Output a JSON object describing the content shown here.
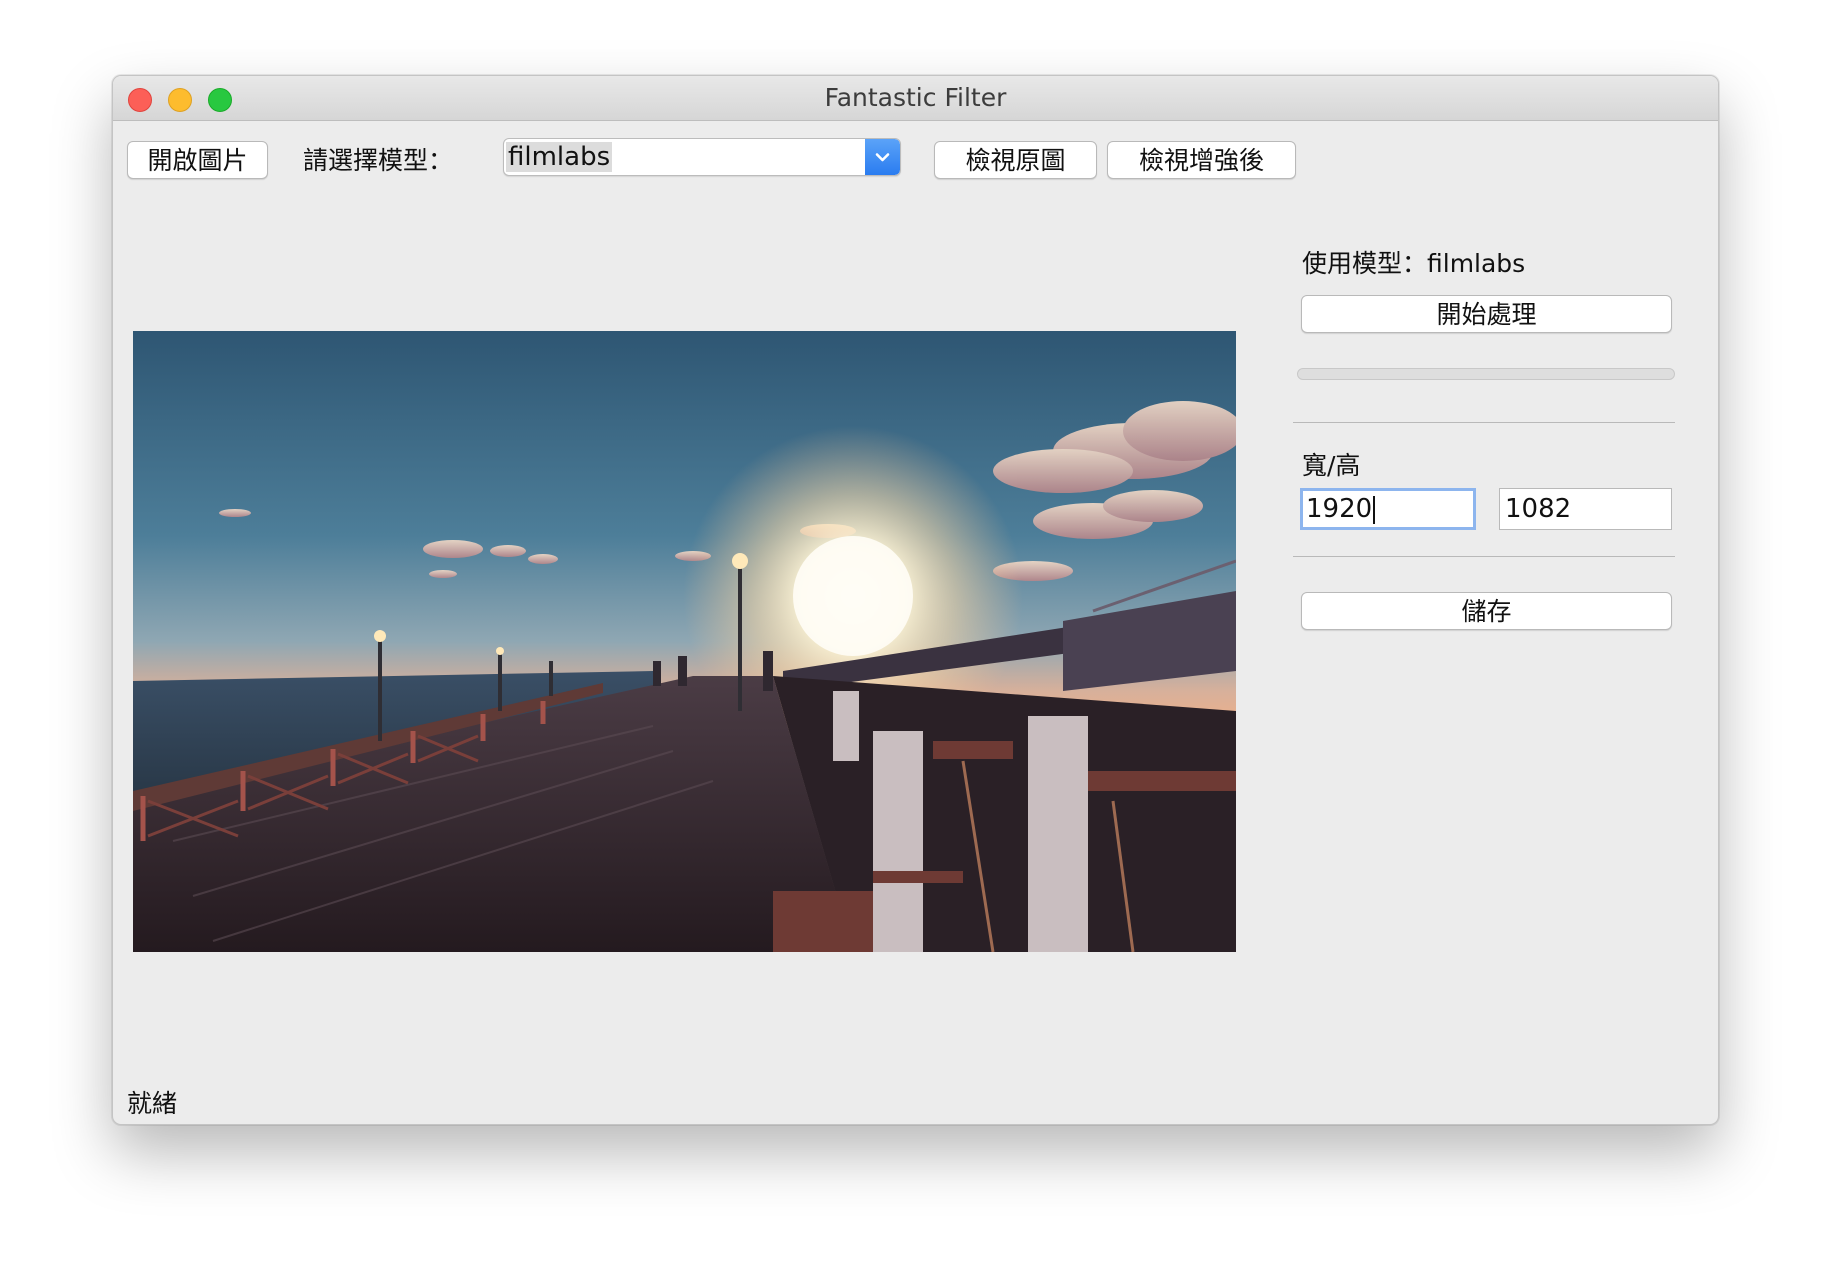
{
  "window": {
    "title": "Fantastic Filter"
  },
  "toolbar": {
    "open_image": "開啟圖片",
    "model_label": "請選擇模型：",
    "model_selected": "filmlabs",
    "view_original": "檢視原圖",
    "view_enhanced": "檢視增強後"
  },
  "preview": {
    "image_subject": "seaside pier at sunset"
  },
  "side": {
    "model_in_use": "使用模型：filmlabs",
    "start_button": "開始處理",
    "progress": 0,
    "size_label": "寬/高",
    "width_value": "1920",
    "height_value": "1082",
    "save_button": "儲存"
  },
  "status": {
    "text": "就緒"
  },
  "colors": {
    "window_bg": "#ececec",
    "select_arrow": "#2a7cf0",
    "focus_ring": "#8db5ee"
  },
  "icons": {
    "close": "close-icon",
    "minimize": "minimize-icon",
    "zoom": "zoom-icon",
    "dropdown": "chevron-down-icon"
  }
}
